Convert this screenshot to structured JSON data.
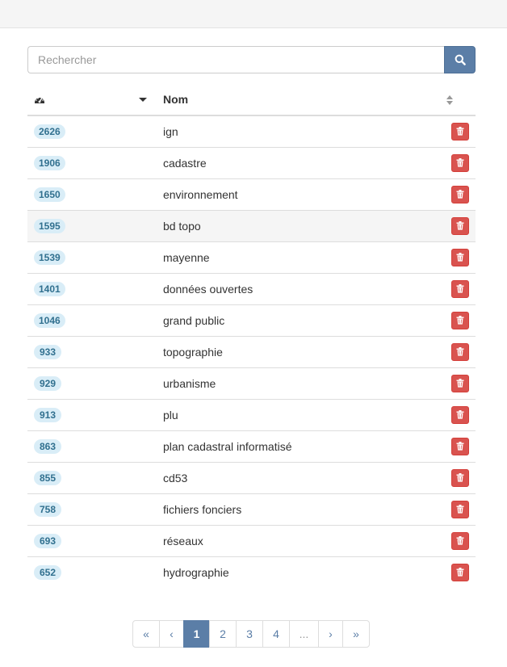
{
  "search": {
    "placeholder": "Rechercher",
    "button_icon": "search-icon"
  },
  "table": {
    "header": {
      "count_icon": "tachometer-icon",
      "name_label": "Nom"
    },
    "rows": [
      {
        "count": "2626",
        "name": "ign"
      },
      {
        "count": "1906",
        "name": "cadastre"
      },
      {
        "count": "1650",
        "name": "environnement"
      },
      {
        "count": "1595",
        "name": "bd topo"
      },
      {
        "count": "1539",
        "name": "mayenne"
      },
      {
        "count": "1401",
        "name": "données ouvertes"
      },
      {
        "count": "1046",
        "name": "grand public"
      },
      {
        "count": "933",
        "name": "topographie"
      },
      {
        "count": "929",
        "name": "urbanisme"
      },
      {
        "count": "913",
        "name": "plu"
      },
      {
        "count": "863",
        "name": "plan cadastral informatisé"
      },
      {
        "count": "855",
        "name": "cd53"
      },
      {
        "count": "758",
        "name": "fichiers fonciers"
      },
      {
        "count": "693",
        "name": "réseaux"
      },
      {
        "count": "652",
        "name": "hydrographie"
      }
    ]
  },
  "pagination": {
    "first": "«",
    "prev": "‹",
    "pages": [
      "1",
      "2",
      "3",
      "4"
    ],
    "ellipsis": "...",
    "next": "›",
    "last": "»"
  },
  "colors": {
    "accent": "#5b7ea7",
    "danger": "#d9534f",
    "badge_bg": "#d9edf7",
    "badge_text": "#31708f"
  }
}
